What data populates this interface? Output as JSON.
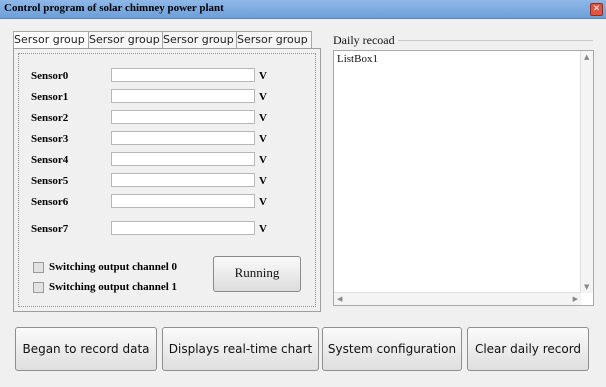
{
  "window": {
    "title": "Control program of solar chimney power plant"
  },
  "tabs": [
    {
      "label": "Sersor group A"
    },
    {
      "label": "Sersor group B"
    },
    {
      "label": "Sersor group C"
    },
    {
      "label": "Sersor group D"
    }
  ],
  "sensors": [
    {
      "label": "Sensor0",
      "value": "",
      "unit": "V"
    },
    {
      "label": "Sensor1",
      "value": "",
      "unit": "V"
    },
    {
      "label": "Sensor2",
      "value": "",
      "unit": "V"
    },
    {
      "label": "Sensor3",
      "value": "",
      "unit": "V"
    },
    {
      "label": "Sensor4",
      "value": "",
      "unit": "V"
    },
    {
      "label": "Sensor5",
      "value": "",
      "unit": "V"
    },
    {
      "label": "Sensor6",
      "value": "",
      "unit": "V"
    },
    {
      "label": "Sensor7",
      "value": "",
      "unit": "V"
    }
  ],
  "checkboxes": [
    {
      "label": "Switching output channel 0",
      "checked": false
    },
    {
      "label": "Switching output channel 1",
      "checked": false
    }
  ],
  "running_button": {
    "label": "Running"
  },
  "daily_record": {
    "label": "Daily recoad",
    "items": [
      "ListBox1"
    ]
  },
  "bottom_buttons": [
    {
      "label": "Began to record data"
    },
    {
      "label": "Displays real-time chart"
    },
    {
      "label": "System configuration"
    },
    {
      "label": "Clear daily record"
    }
  ],
  "colors": {
    "titlebar": "#7aa8e0",
    "close": "#e4533b",
    "background": "#f0f0f0"
  }
}
